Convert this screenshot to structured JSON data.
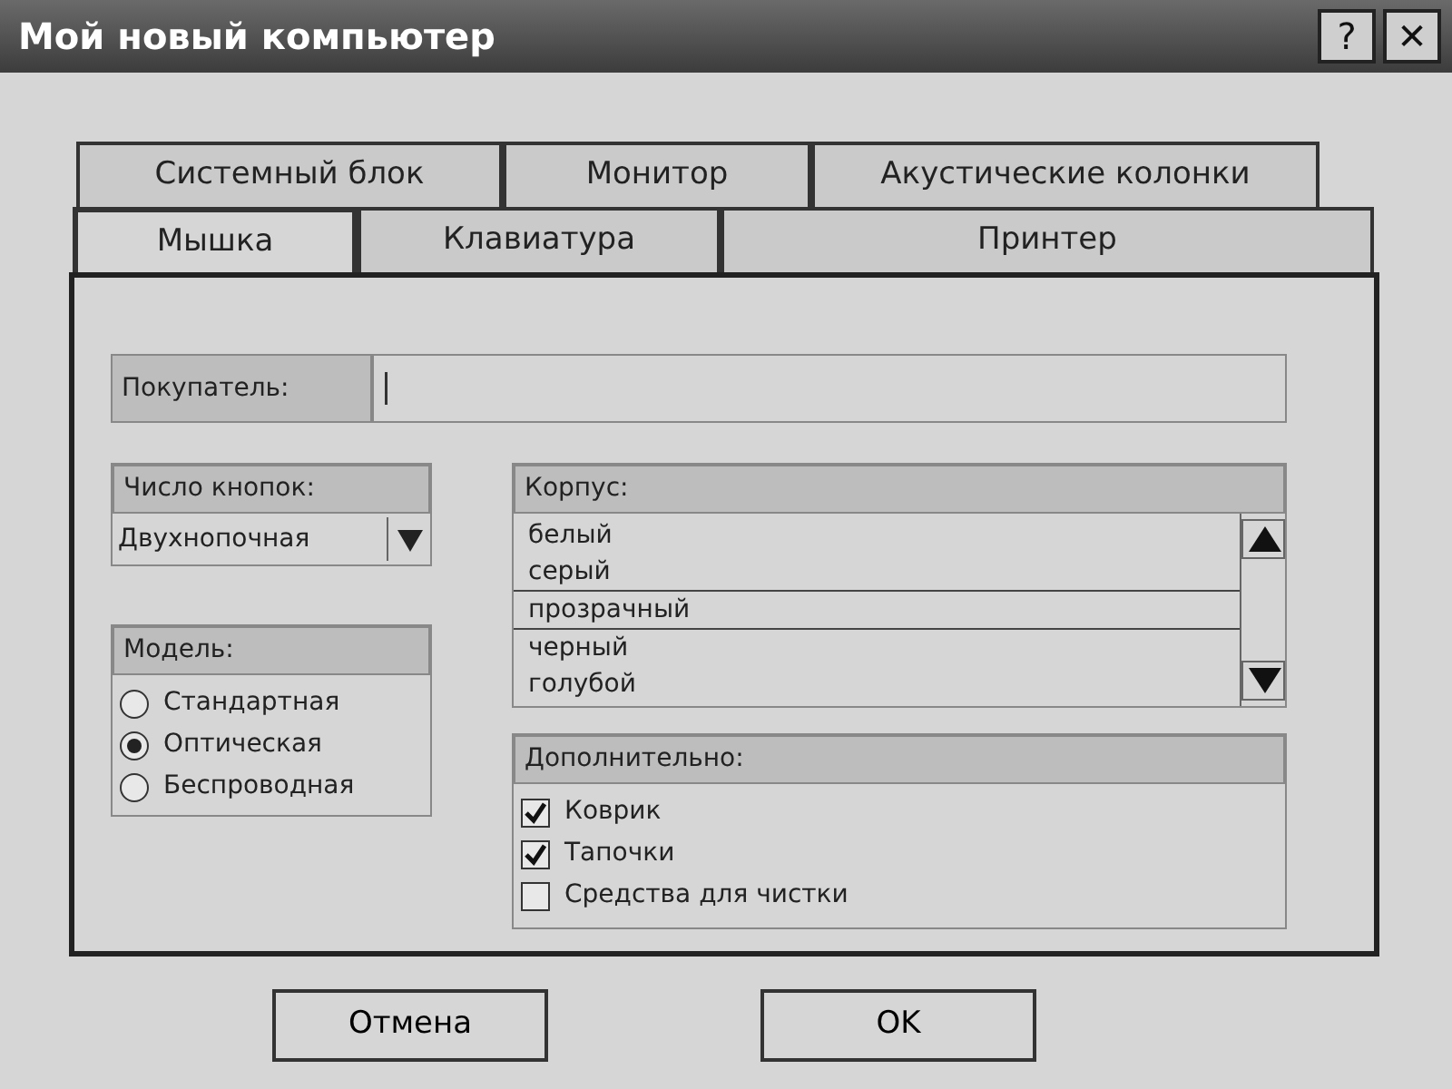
{
  "window": {
    "title": "Мой новый компьютер",
    "buttons": [
      "?",
      "✕"
    ]
  },
  "tab_rows": [
    [
      {
        "label": "Системный блок",
        "selected": false
      },
      {
        "label": "Монитор",
        "selected": false
      },
      {
        "label": "Акустические колонки",
        "selected": false
      }
    ],
    [
      {
        "label": "Мышка",
        "selected": true
      },
      {
        "label": "Клавиатура",
        "selected": false
      },
      {
        "label": "Принтер",
        "selected": false
      }
    ]
  ],
  "buyer": {
    "label": "Покупатель:"
  },
  "buttons_count": {
    "label": "Число кнопок:",
    "value": "Двухнопочная"
  },
  "model": {
    "label": "Модель:",
    "options": [
      {
        "label": "Стандартная",
        "selected": false
      },
      {
        "label": "Оптическая",
        "selected": true
      },
      {
        "label": "Беспроводная",
        "selected": false
      }
    ]
  },
  "body": {
    "label": "Корпус:",
    "items": [
      {
        "label": "белый",
        "selected": false
      },
      {
        "label": "серый",
        "selected": false
      },
      {
        "label": "прозрачный",
        "selected": true
      },
      {
        "label": "черный",
        "selected": false
      },
      {
        "label": "голубой",
        "selected": false
      }
    ]
  },
  "extras": {
    "label": "Дополнительно:",
    "items": [
      {
        "label": "Коврик",
        "checked": true
      },
      {
        "label": "Тапочки",
        "checked": true
      },
      {
        "label": "Средства для чистки",
        "checked": false
      }
    ]
  },
  "footer_buttons": [
    "Отмена",
    "OK"
  ]
}
